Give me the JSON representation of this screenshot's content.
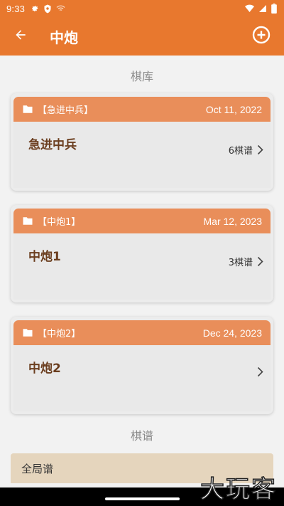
{
  "status_bar": {
    "time": "9:33",
    "icons_left": [
      "gear-icon",
      "shield-icon",
      "wifi-off-icon"
    ],
    "icons_right": [
      "wifi-icon",
      "signal-icon",
      "battery-icon"
    ]
  },
  "app_bar": {
    "title": "中炮",
    "back_icon": "arrow-left-icon",
    "add_icon": "plus-circle-icon"
  },
  "sections": {
    "library_label": "棋库",
    "records_label": "棋谱"
  },
  "cards": [
    {
      "tag": "【急进中兵】",
      "date": "Oct 11, 2022",
      "name": "急进中兵",
      "count": "6棋谱"
    },
    {
      "tag": "【中炮1】",
      "date": "Mar 12, 2023",
      "name": "中炮1",
      "count": "3棋谱"
    },
    {
      "tag": "【中炮2】",
      "date": "Dec 24, 2023",
      "name": "中炮2",
      "count": ""
    }
  ],
  "records": [
    {
      "label": "全局谱"
    }
  ],
  "watermark": "大玩客",
  "colors": {
    "primary": "#e8782e",
    "card_header": "#e98e5a",
    "card_title": "#6b3e1f",
    "record_bg": "#e5d5bd"
  }
}
